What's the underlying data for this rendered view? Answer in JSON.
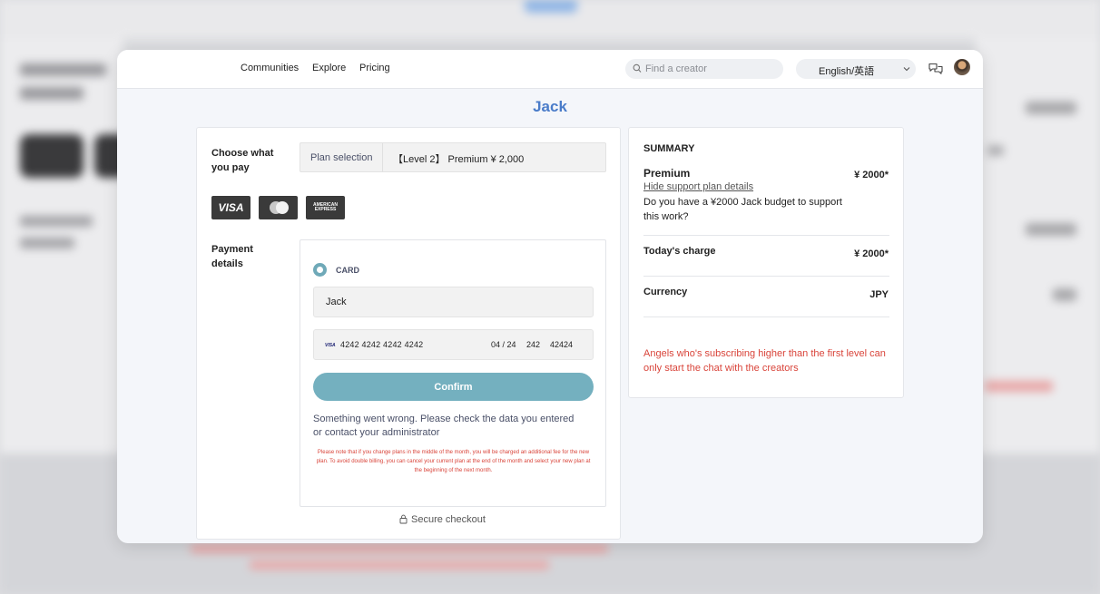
{
  "nav": {
    "communities": "Communities",
    "explore": "Explore",
    "pricing": "Pricing"
  },
  "search": {
    "placeholder": "Find a creator",
    "value": ""
  },
  "language": {
    "selected": "English/英語"
  },
  "page": {
    "title": "Jack"
  },
  "plan": {
    "section_label": "Choose what you pay",
    "selection_label": "Plan selection",
    "selected_plan": "【Level 2】 Premium ¥ 2,000"
  },
  "card_logos": {
    "visa": "VISA",
    "amex": "AMERICAN EXPRESS"
  },
  "payment": {
    "section_label": "Payment details",
    "method_label": "CARD",
    "name_value": "Jack",
    "card_brand": "VISA",
    "card_number": "4242 4242 4242 4242",
    "expiry": "04 / 24",
    "cvc": "242",
    "zip": "42424",
    "confirm_label": "Confirm",
    "error_message": "Something went wrong. Please check the data you entered or contact your administrator",
    "notice": "Please note that if you change plans in the middle of the month, you will be charged an additional fee for the new plan. To avoid double billing, you can cancel your current plan at the end of the month and select your new plan at the beginning of the next month.",
    "secure_label": "Secure checkout"
  },
  "summary": {
    "title": "SUMMARY",
    "plan_name": "Premium",
    "plan_price": "¥ 2000*",
    "hide_link": "Hide support plan details",
    "budget_question": "Do you have a ¥2000 Jack budget to support this work?",
    "today_label": "Today's charge",
    "today_price": "¥ 2000*",
    "currency_label": "Currency",
    "currency_value": "JPY",
    "angels_note": "Angels who's subscribing higher than the first level can only start the chat with the creators"
  },
  "colors": {
    "accent": "#4a7cc9",
    "confirm_button": "#74b0bf",
    "error_red": "#d9443a"
  }
}
